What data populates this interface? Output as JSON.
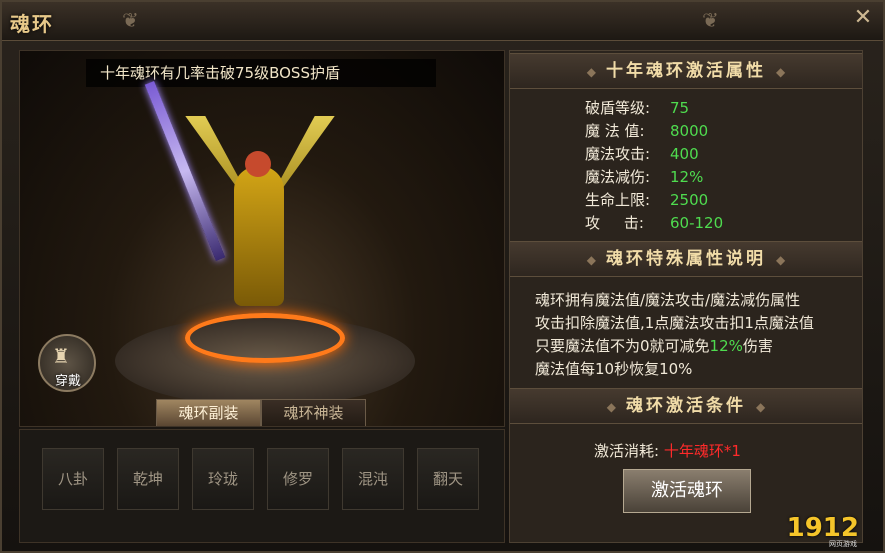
{
  "window": {
    "title": "魂环",
    "close_icon": "close-icon"
  },
  "stage": {
    "caption": "十年魂环有几率击破75级BOSS护盾",
    "equip_button_label": "穿戴",
    "tabs": [
      {
        "label": "魂环副装",
        "active": true
      },
      {
        "label": "魂环神装",
        "active": false
      }
    ]
  },
  "slots": [
    "八卦",
    "乾坤",
    "玲珑",
    "修罗",
    "混沌",
    "翻天"
  ],
  "panel": {
    "attributes_title": "十年魂环激活属性",
    "attributes": [
      {
        "label": "破盾等级:",
        "value": "75"
      },
      {
        "label": "魔 法 值:",
        "value": "8000"
      },
      {
        "label": "魔法攻击:",
        "value": "400"
      },
      {
        "label": "魔法减伤:",
        "value": "12%"
      },
      {
        "label": "生命上限:",
        "value": "2500"
      },
      {
        "label": "攻     击:",
        "value": "60-120"
      }
    ],
    "special_title": "魂环特殊属性说明",
    "special_lines": [
      "魂环拥有魔法值/魔法攻击/魔法减伤属性",
      "攻击扣除魔法值,1点魔法攻击扣1点魔法值",
      {
        "pre": "只要魔法值不为0就可减免",
        "hl": "12%",
        "post": "伤害"
      },
      "魔法值每10秒恢复10%"
    ],
    "condition_title": "魂环激活条件",
    "cost_label": "激活消耗:",
    "cost_value": "十年魂环*1",
    "activate_button": "激活魂环"
  },
  "watermark": {
    "logo": "1912",
    "sub": "网页游戏"
  },
  "colors": {
    "accent_green": "#4fdc4f",
    "cost_red": "#ff2a2a",
    "gold": "#f1dca8"
  }
}
